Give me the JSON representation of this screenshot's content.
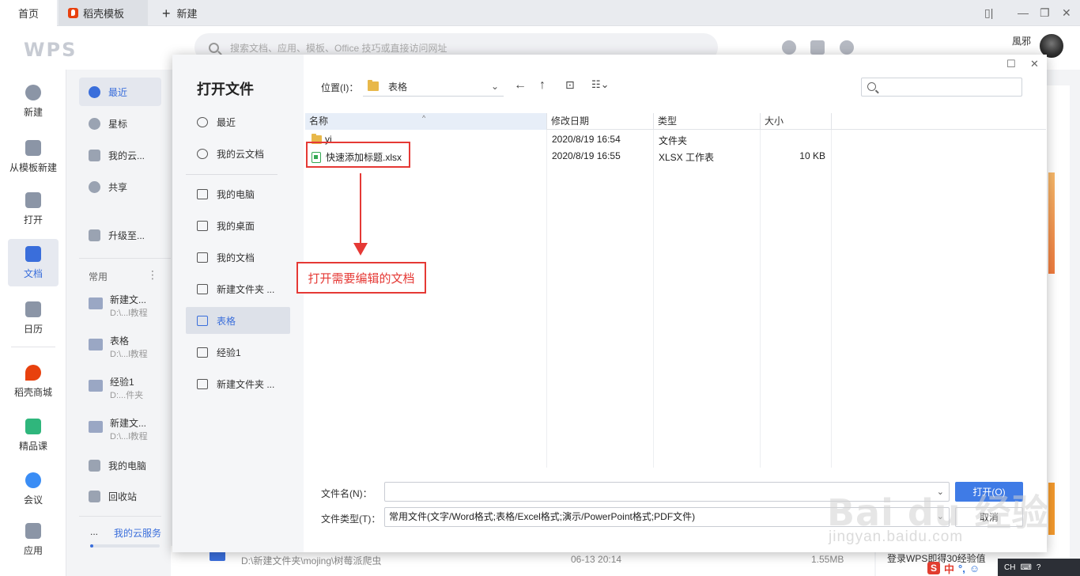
{
  "tabs": {
    "home": "首页",
    "docer": "稻壳模板",
    "new": "新建"
  },
  "header": {
    "logo": "WPS",
    "search_placeholder": "搜索文档、应用、模板、Office 技巧或直接访问网址",
    "username": "風邪"
  },
  "rail": {
    "items": [
      {
        "label": "新建"
      },
      {
        "label": "从模板新建"
      },
      {
        "label": "打开"
      },
      {
        "label": "文档"
      },
      {
        "label": "日历"
      },
      {
        "label": "稻壳商城"
      },
      {
        "label": "精品课"
      },
      {
        "label": "会议"
      },
      {
        "label": "应用"
      }
    ]
  },
  "nav": {
    "items": [
      {
        "label": "最近"
      },
      {
        "label": "星标"
      },
      {
        "label": "我的云..."
      },
      {
        "label": "共享"
      },
      {
        "label": "升级至..."
      }
    ],
    "section_label": "常用",
    "section_more": "⋮",
    "recents": [
      {
        "name": "新建文...",
        "path": "D:\\...l教程"
      },
      {
        "name": "表格",
        "path": "D:\\...l教程"
      },
      {
        "name": "经验1",
        "path": "D:...件夹"
      },
      {
        "name": "新建文...",
        "path": "D:\\...l教程"
      }
    ],
    "my_computer": "我的电脑",
    "recycle": "回收站",
    "cloud_service_dots": "...",
    "cloud_service": "我的云服务"
  },
  "background": {
    "bottom_row_path": "D:\\新建文件夹\\mojing\\树莓派爬虫",
    "bottom_row_date": "06-13 20:14",
    "bottom_row_size": "1.55MB",
    "login_hint": "登录WPS即得30经验值"
  },
  "dialog": {
    "title": "打开文件",
    "places": [
      {
        "label": "最近"
      },
      {
        "label": "我的云文档"
      },
      {
        "label": "我的电脑"
      },
      {
        "label": "我的桌面"
      },
      {
        "label": "我的文档"
      },
      {
        "label": "新建文件夹 ..."
      },
      {
        "label": "表格"
      },
      {
        "label": "经验1"
      },
      {
        "label": "新建文件夹 ..."
      }
    ],
    "location_label": "位置(I)：",
    "location_value": "表格",
    "columns": {
      "name": "名称",
      "modified": "修改日期",
      "type": "类型",
      "size": "大小"
    },
    "files": [
      {
        "name": "yi",
        "modified": "2020/8/19 16:54",
        "type": "文件夹",
        "size": ""
      },
      {
        "name": "快速添加标题.xlsx",
        "modified": "2020/8/19 16:55",
        "type": "XLSX 工作表",
        "size": "10 KB"
      }
    ],
    "annotation": "打开需要编辑的文档",
    "filename_label": "文件名(N)：",
    "filename_value": "",
    "filetype_label": "文件类型(T)：",
    "filetype_value": "常用文件(文字/Word格式;表格/Excel格式;演示/PowerPoint格式;PDF文件)",
    "open_button": "打开(O)",
    "cancel_button": "取消"
  },
  "watermark": {
    "main": "Bai du 经验",
    "sub": "jingyan.baidu.com"
  },
  "taskbar": {
    "lang": "CH",
    "ime_zh": "中",
    "ime_punct": "°,"
  }
}
